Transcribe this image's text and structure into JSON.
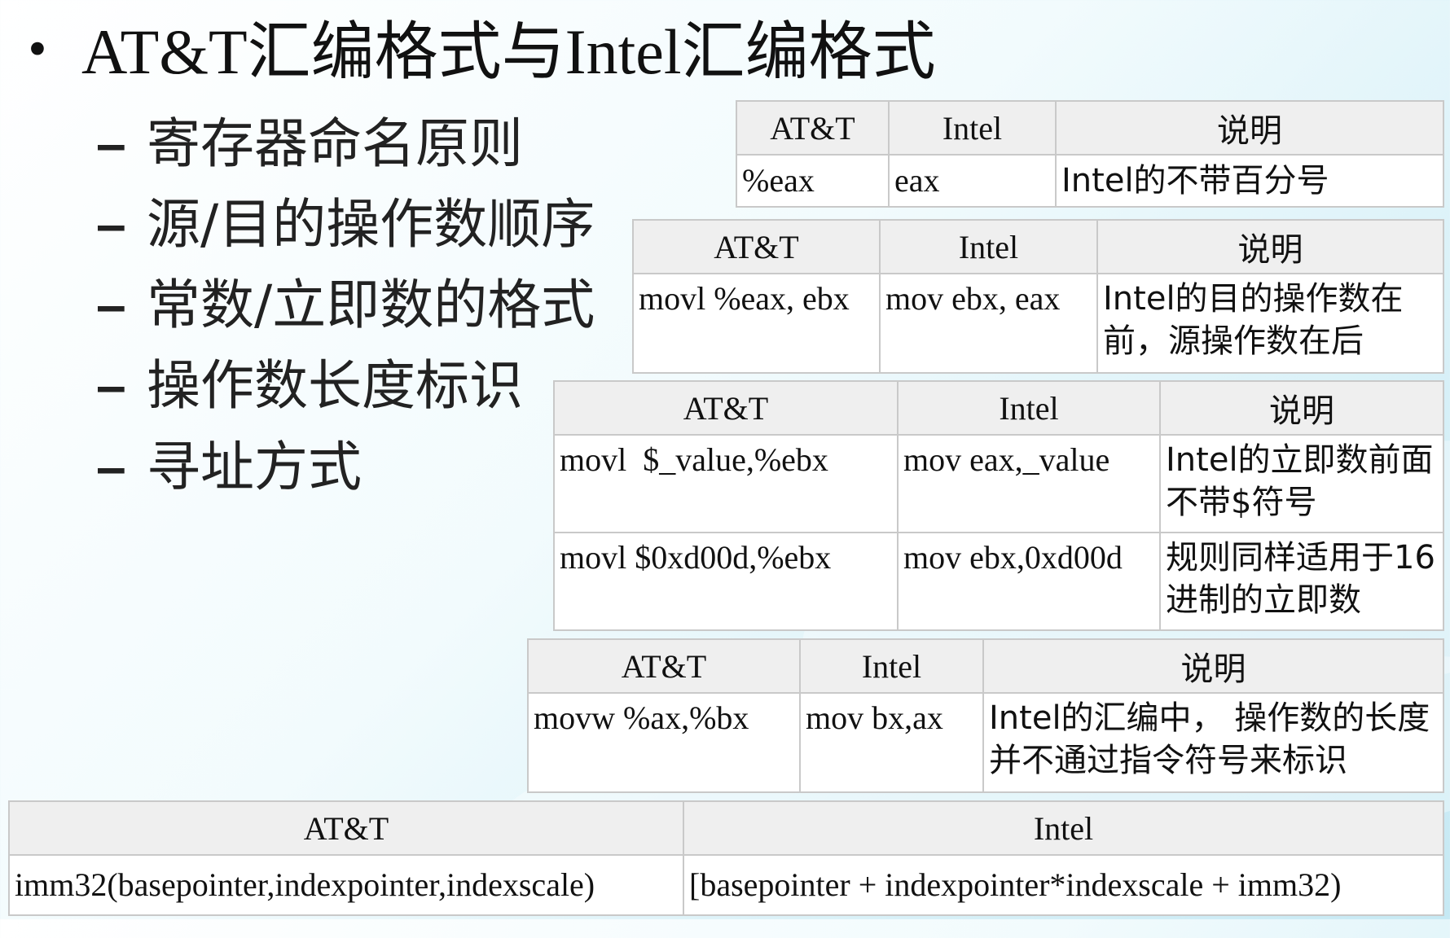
{
  "title": {
    "bullet": "•",
    "text": "AT&T汇编格式与Intel汇编格式"
  },
  "subitems": [
    {
      "dash": "–",
      "text": "寄存器命名原则"
    },
    {
      "dash": "–",
      "text": "源/目的操作数顺序"
    },
    {
      "dash": "–",
      "text": "常数/立即数的格式"
    },
    {
      "dash": "–",
      "text": "操作数长度标识"
    },
    {
      "dash": "–",
      "text": "寻址方式"
    }
  ],
  "tables": {
    "registers": {
      "headers": [
        "AT&T",
        "Intel",
        "说明"
      ],
      "rows": [
        [
          "%eax",
          "eax",
          "Intel的不带百分号"
        ]
      ]
    },
    "operand_order": {
      "headers": [
        "AT&T",
        "Intel",
        "说明"
      ],
      "rows": [
        [
          "movl %eax, ebx",
          "mov ebx, eax",
          "Intel的目的操作数在前，源操作数在后"
        ]
      ]
    },
    "immediates": {
      "headers": [
        "AT&T",
        "Intel",
        "说明"
      ],
      "rows": [
        [
          "movl  $_value,%ebx",
          "mov eax,_value",
          "Intel的立即数前面不带$符号"
        ],
        [
          "movl $0xd00d,%ebx",
          "mov ebx,0xd00d",
          "规则同样适用于16进制的立即数"
        ]
      ]
    },
    "operand_size": {
      "headers": [
        "AT&T",
        "Intel",
        "说明"
      ],
      "rows": [
        [
          "movw %ax,%bx",
          "mov bx,ax",
          "Intel的汇编中， 操作数的长度并不通过指令符号来标识"
        ]
      ]
    },
    "addressing": {
      "headers": [
        "AT&T",
        "Intel"
      ],
      "rows": [
        [
          "imm32(basepointer,indexpointer,indexscale)",
          "[basepointer + indexpointer*indexscale + imm32)"
        ]
      ]
    }
  }
}
